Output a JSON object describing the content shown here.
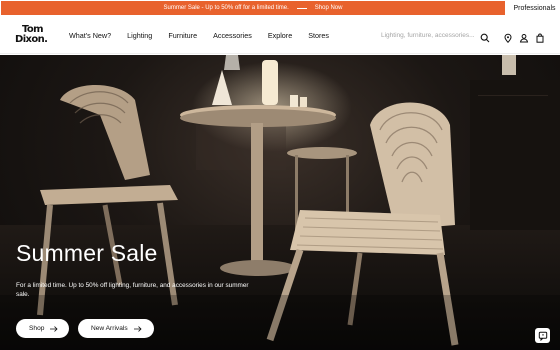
{
  "promo": {
    "message": "Summer Sale - Up to 50% off for a limited time.",
    "link_label": "Shop Now",
    "professionals_label": "Professionals",
    "bar_color": "#e8622d"
  },
  "header": {
    "logo_line1": "Tom",
    "logo_line2": "Dixon.",
    "nav": [
      "What's New?",
      "Lighting",
      "Furniture",
      "Accessories",
      "Explore",
      "Stores"
    ],
    "search_placeholder": "Lighting, furniture, accessories...",
    "icons": [
      "search-icon",
      "location-pin-icon",
      "user-icon",
      "shopping-bag-icon"
    ]
  },
  "hero": {
    "title": "Summer Sale",
    "description": "For a limited time. Up to 50% off lighting, furniture, and accessories in our summer sale.",
    "buttons": {
      "shop_label": "Shop",
      "new_arrivals_label": "New Arrivals"
    },
    "chat_icon": "chat-icon"
  }
}
